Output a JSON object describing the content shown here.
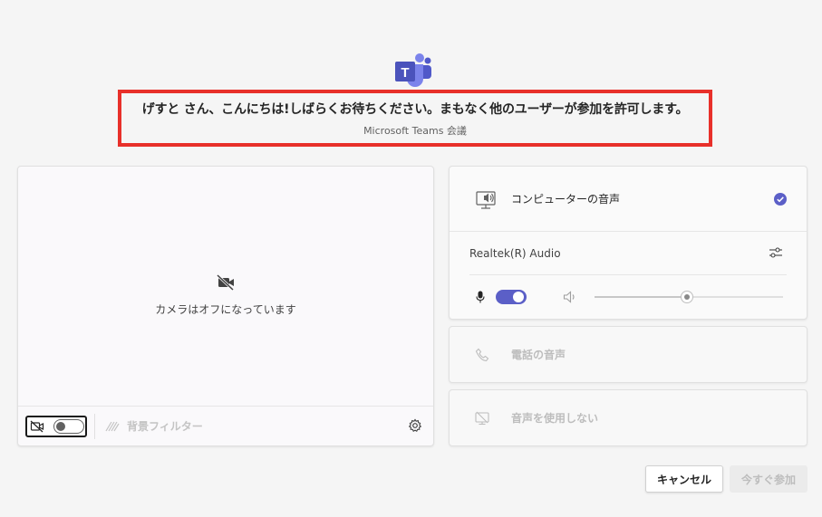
{
  "header": {
    "title": "げすと さん、こんにちは!しばらくお待ちください。まもなく他のユーザーが参加を許可します。",
    "subtitle": "Microsoft Teams 会議"
  },
  "logo": {
    "icon": "teams-logo-icon",
    "letter": "T"
  },
  "video": {
    "camera_off_text": "カメラはオフになっています",
    "background_filter_label": "背景フィルター",
    "camera_toggle_state": "off"
  },
  "audio": {
    "computer_audio_label": "コンピューターの音声",
    "computer_audio_selected": true,
    "device_name": "Realtek(R) Audio",
    "mic_on": true,
    "volume_level": 0.49,
    "phone_audio_label": "電話の音声",
    "no_audio_label": "音声を使用しない"
  },
  "buttons": {
    "cancel_label": "キャンセル",
    "join_label": "今すぐ参加"
  },
  "colors": {
    "accent": "#5b5fc7",
    "highlight_border": "#e8302a"
  }
}
